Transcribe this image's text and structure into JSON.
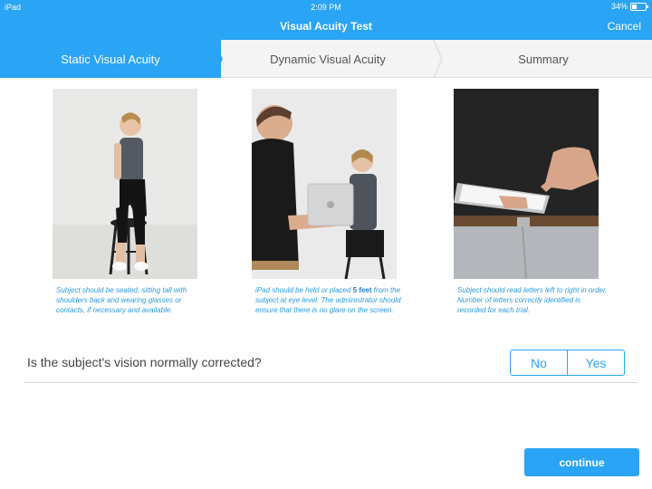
{
  "status": {
    "carrier": "iPad",
    "time": "2:09 PM",
    "battery": "34%"
  },
  "nav": {
    "title": "Visual Acuity Test",
    "cancel_label": "Cancel"
  },
  "steps": [
    {
      "label": "Static Visual Acuity",
      "active": true
    },
    {
      "label": "Dynamic Visual Acuity",
      "active": false
    },
    {
      "label": "Summary",
      "active": false
    }
  ],
  "captions": [
    {
      "text": "Subject should be seated, sitting tall with shoulders back and wearing glasses or contacts, if necessary and available."
    },
    {
      "before": "iPad should be held or placed ",
      "bold": "5 feet",
      "after": " from the subject at eye level. The administrator should ensure that there is no glare on the screen."
    },
    {
      "text": "Subject should read letters left to right in order. Number of letters correctly identified is recorded for each trial."
    }
  ],
  "question": {
    "text": "Is the subject's vision normally corrected?",
    "options": [
      "No",
      "Yes"
    ]
  },
  "continue_label": "continue",
  "colors": {
    "accent": "#2aa4f4",
    "caption": "#2a9be6"
  }
}
